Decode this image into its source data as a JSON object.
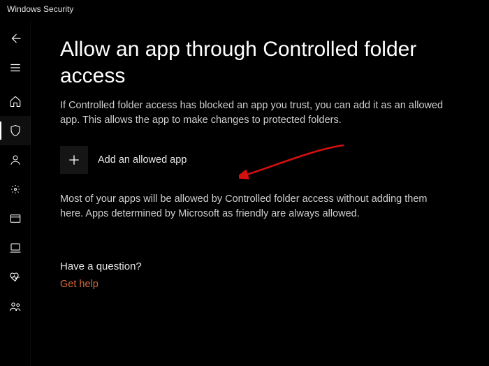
{
  "window": {
    "title": "Windows Security"
  },
  "sidebar": {
    "items": [
      {
        "name": "back-icon"
      },
      {
        "name": "menu-icon"
      },
      {
        "name": "home-icon"
      },
      {
        "name": "shield-icon",
        "selected": true
      },
      {
        "name": "account-icon"
      },
      {
        "name": "firewall-icon"
      },
      {
        "name": "app-browser-icon"
      },
      {
        "name": "device-icon"
      },
      {
        "name": "health-icon"
      },
      {
        "name": "family-icon"
      }
    ]
  },
  "main": {
    "heading": "Allow an app through Controlled folder access",
    "description": "If Controlled folder access has blocked an app you trust, you can add it as an allowed app. This allows the app to make changes to protected folders.",
    "add_button_label": "Add an allowed app",
    "note": "Most of your apps will be allowed by Controlled folder access without adding them here. Apps determined by Microsoft as friendly are always allowed.",
    "question_heading": "Have a question?",
    "help_link": "Get help"
  }
}
